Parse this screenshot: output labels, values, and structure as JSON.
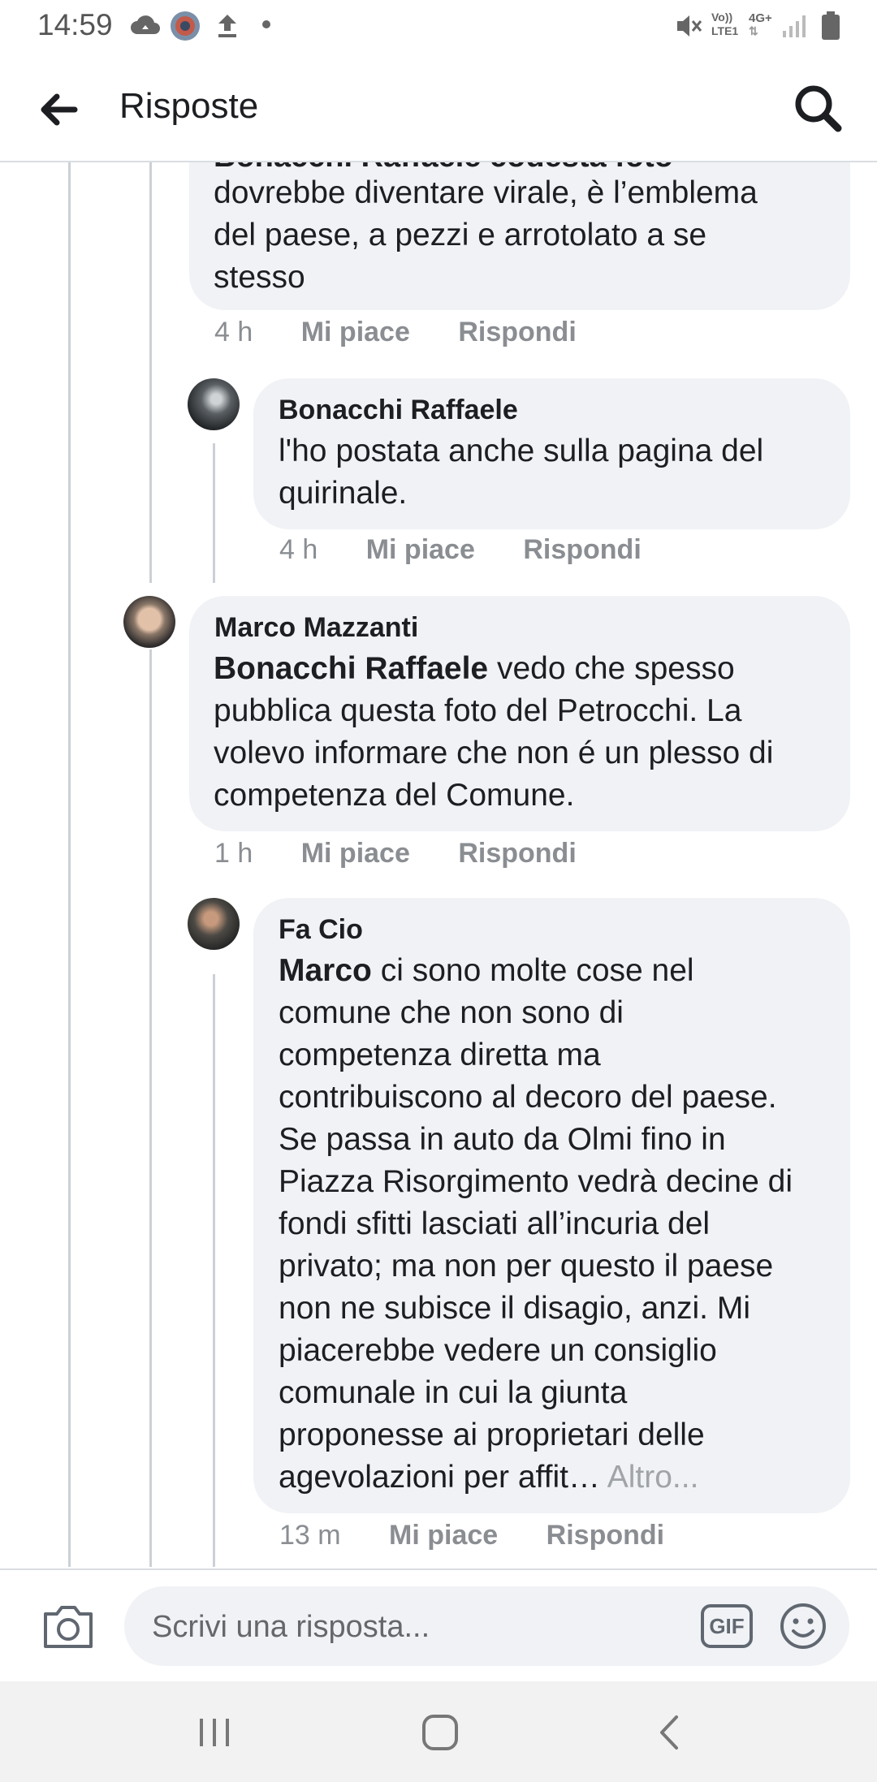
{
  "status_bar": {
    "time": "14:59",
    "left_icons": [
      "cloud-sync-icon",
      "app-badge-icon",
      "upload-icon",
      "dot-icon"
    ],
    "right_icons": [
      "mute-icon",
      "volte-icon",
      "network-4g-icon",
      "signal-icon",
      "battery-icon"
    ],
    "volte_label": "Vo))\nLTE1",
    "network_label": "4G+"
  },
  "header": {
    "back_icon": "arrow-left-icon",
    "title": "Risposte",
    "search_icon": "search-icon"
  },
  "comments": [
    {
      "id": "c1",
      "author_partial": "Bonacchi Raffaele  codesta foto",
      "text": "dovrebbe diventare virale, è l’emblema\ndel paese, a pezzi e arrotolato a se\nstesso",
      "time": "4 h",
      "like": "Mi piace",
      "reply": "Rispondi"
    },
    {
      "id": "c2",
      "author": "Bonacchi Raffaele",
      "text": "l'ho postata anche sulla pagina del\nquirinale.",
      "time": "4 h",
      "like": "Mi piace",
      "reply": "Rispondi"
    },
    {
      "id": "c3",
      "author": "Marco Mazzanti",
      "mention": "Bonacchi Raffaele",
      "text": " vedo che spesso\npubblica questa foto del Petrocchi. La\nvolevo informare che non é un plesso di\ncompetenza del Comune.",
      "time": "1 h",
      "like": "Mi piace",
      "reply": "Rispondi"
    },
    {
      "id": "c4",
      "author": "Fa Cio",
      "mention": "Marco",
      "text": " ci sono molte cose nel\ncomune che non sono di\ncompetenza diretta ma\ncontribuiscono al decoro del paese.\nSe passa in auto da Olmi fino in\nPiazza Risorgimento vedrà decine di\nfondi sfitti lasciati all’incuria del\nprivato; ma non per questo il paese\nnon ne subisce il disagio, anzi. Mi\npiacerebbe vedere un consiglio\ncomunale in cui la giunta\nproponesse ai proprietari delle\nagevolazioni per affit…",
      "more": " Altro...",
      "time": "13 m",
      "like": "Mi piace",
      "reply": "Rispondi"
    }
  ],
  "composer": {
    "camera_icon": "camera-icon",
    "placeholder": "Scrivi una risposta...",
    "gif_label": "GIF",
    "emoji_icon": "smiley-icon"
  },
  "navbar": {
    "icons": [
      "recent-apps-icon",
      "home-icon",
      "back-icon"
    ]
  }
}
